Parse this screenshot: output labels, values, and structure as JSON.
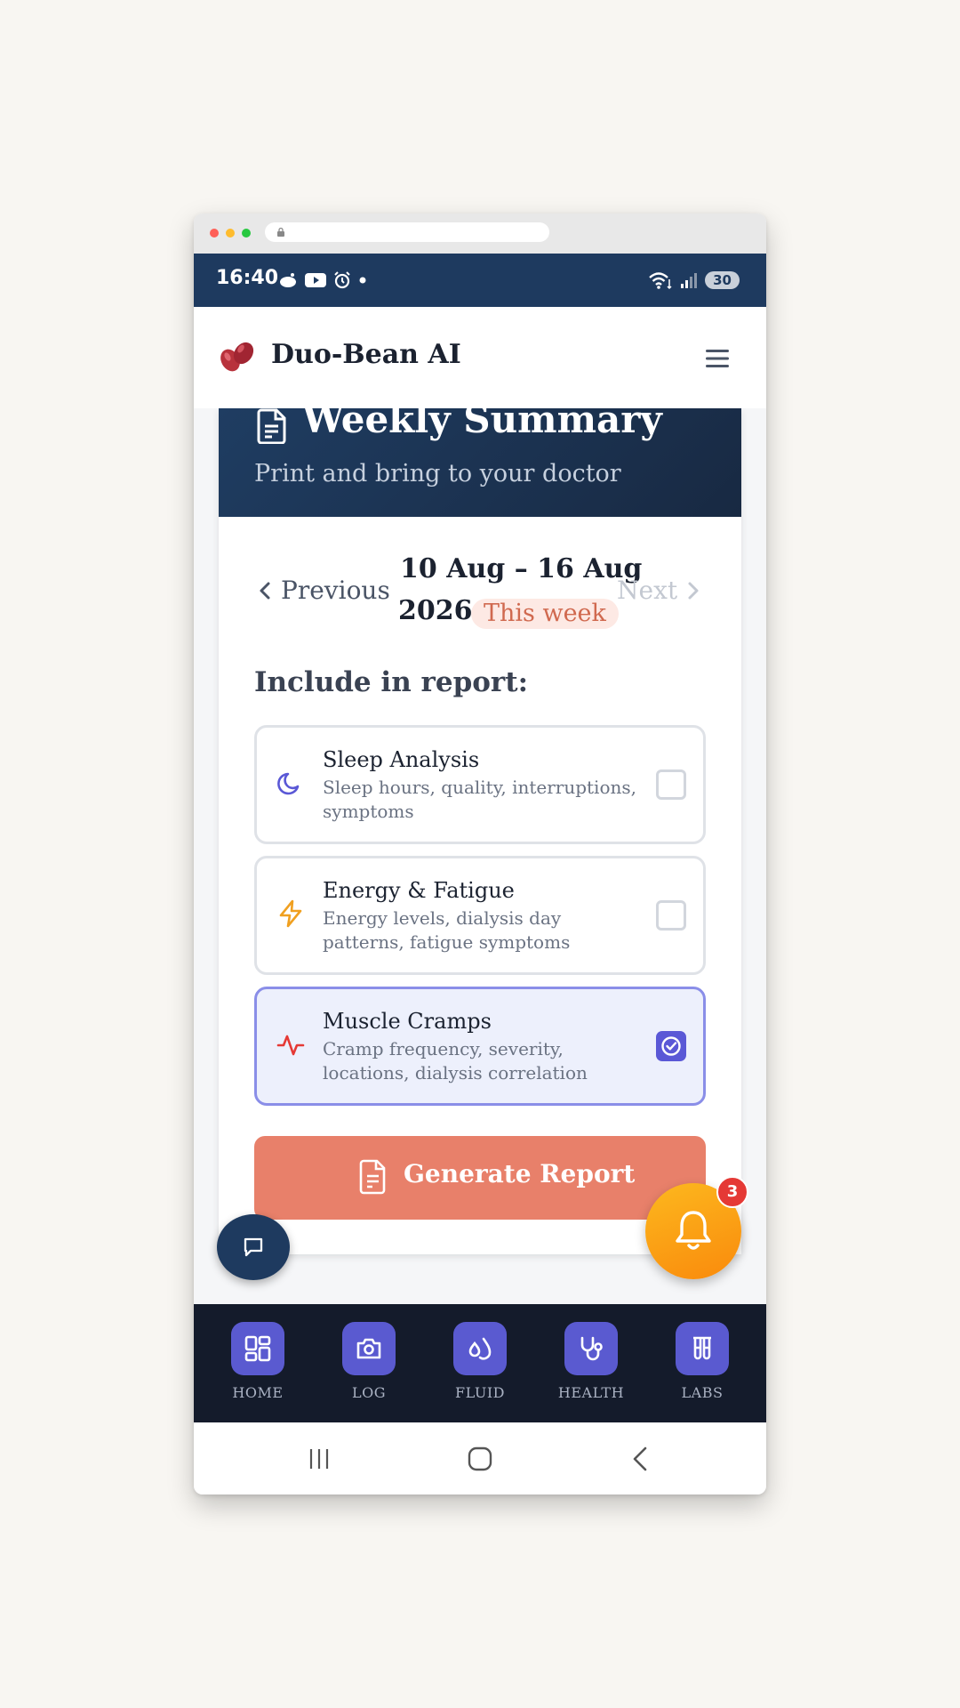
{
  "status_bar": {
    "time": "16:40",
    "battery": "30"
  },
  "app": {
    "title": "Duo-Bean AI"
  },
  "summary": {
    "title": "Weekly Summary",
    "subtitle": "Print and bring to your doctor"
  },
  "week_nav": {
    "prev_label": "Previous",
    "next_label": "Next",
    "range_line1": "10 Aug – 16 Aug",
    "range_line2": "2026",
    "badge": "This week"
  },
  "include_label": "Include in report:",
  "options": [
    {
      "title": "Sleep Analysis",
      "desc": "Sleep hours, quality, interruptions, symptoms",
      "checked": false,
      "icon": "moon-icon",
      "color": "#5a58d6"
    },
    {
      "title": "Energy & Fatigue",
      "desc": "Energy levels, dialysis day patterns, fatigue symptoms",
      "checked": false,
      "icon": "lightning-icon",
      "color": "#f0a020"
    },
    {
      "title": "Muscle Cramps",
      "desc": "Cramp frequency, severity, locations, dialysis correlation",
      "checked": true,
      "icon": "activity-icon",
      "color": "#e53935"
    }
  ],
  "generate_button": "Generate Report",
  "notifications": {
    "count": "3"
  },
  "bottom_nav": [
    {
      "label": "HOME",
      "icon": "grid-icon"
    },
    {
      "label": "LOG",
      "icon": "camera-icon"
    },
    {
      "label": "FLUID",
      "icon": "droplets-icon"
    },
    {
      "label": "HEALTH",
      "icon": "stethoscope-icon"
    },
    {
      "label": "LABS",
      "icon": "test-tubes-icon"
    }
  ],
  "colors": {
    "primary": "#5a58d6",
    "navy": "#1e3a5f",
    "accent": "#e8806a",
    "bell": "#f98a0c"
  }
}
